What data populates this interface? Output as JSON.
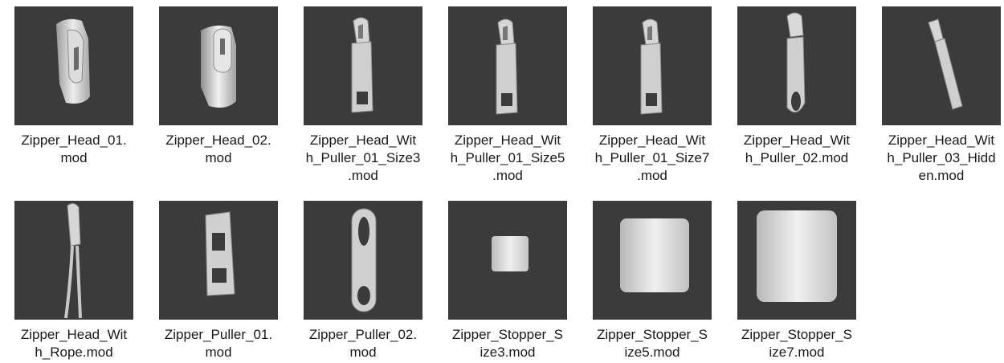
{
  "files": [
    {
      "name": "Zipper_Head_01.\nmod",
      "icon": "zipper-head-icon"
    },
    {
      "name": "Zipper_Head_02.\nmod",
      "icon": "zipper-head-icon"
    },
    {
      "name": "Zipper_Head_Wit\nh_Puller_01_Size3\n.mod",
      "icon": "zipper-head-with-puller-icon"
    },
    {
      "name": "Zipper_Head_Wit\nh_Puller_01_Size5\n.mod",
      "icon": "zipper-head-with-puller-icon"
    },
    {
      "name": "Zipper_Head_Wit\nh_Puller_01_Size7\n.mod",
      "icon": "zipper-head-with-puller-icon"
    },
    {
      "name": "Zipper_Head_Wit\nh_Puller_02.mod",
      "icon": "zipper-head-with-puller-icon"
    },
    {
      "name": "Zipper_Head_Wit\nh_Puller_03_Hidd\nen.mod",
      "icon": "zipper-head-hidden-icon"
    },
    {
      "name": "Zipper_Head_Wit\nh_Rope.mod",
      "icon": "zipper-head-rope-icon"
    },
    {
      "name": "Zipper_Puller_01.\nmod",
      "icon": "zipper-puller-icon"
    },
    {
      "name": "Zipper_Puller_02.\nmod",
      "icon": "zipper-puller-icon"
    },
    {
      "name": "Zipper_Stopper_S\nize3.mod",
      "icon": "zipper-stopper-icon"
    },
    {
      "name": "Zipper_Stopper_S\nize5.mod",
      "icon": "zipper-stopper-icon"
    },
    {
      "name": "Zipper_Stopper_S\nize7.mod",
      "icon": "zipper-stopper-icon"
    }
  ]
}
